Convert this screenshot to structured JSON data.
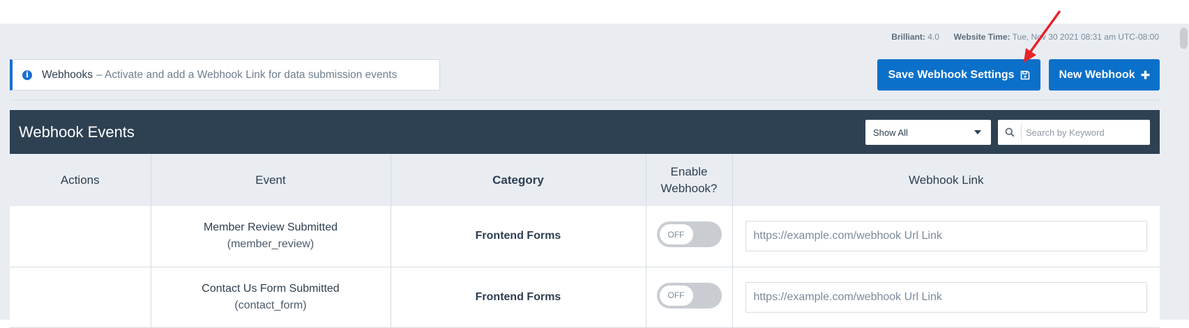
{
  "meta": {
    "brilliant_label": "Brilliant:",
    "brilliant_value": "4.0",
    "time_label": "Website Time:",
    "time_value": "Tue, Nov 30 2021 08:31 am UTC-08:00"
  },
  "notice": {
    "icon": "info-icon",
    "title": "Webhooks",
    "text": "– Activate and add a Webhook Link for data submission events"
  },
  "buttons": {
    "save_label": "Save Webhook Settings",
    "save_icon": "floppy-disk-icon",
    "new_label": "New Webhook",
    "new_icon": "plus-icon"
  },
  "panel": {
    "title": "Webhook Events",
    "filter_selected": "Show All",
    "search_placeholder": "Search by Keyword"
  },
  "table": {
    "headers": {
      "actions": "Actions",
      "event": "Event",
      "category": "Category",
      "enable_line1": "Enable",
      "enable_line2": "Webhook?",
      "link": "Webhook Link"
    },
    "rows": [
      {
        "event_name": "Member Review Submitted",
        "event_key": "(member_review)",
        "category": "Frontend Forms",
        "toggle_label": "OFF",
        "link_placeholder": "https://example.com/webhook Url Link"
      },
      {
        "event_name": "Contact Us Form Submitted",
        "event_key": "(contact_form)",
        "category": "Frontend Forms",
        "toggle_label": "OFF",
        "link_placeholder": "https://example.com/webhook Url Link"
      }
    ]
  },
  "colors": {
    "accent": "#0b70c9",
    "panel_header": "#2e4153",
    "annotation_arrow": "#e8222a"
  }
}
